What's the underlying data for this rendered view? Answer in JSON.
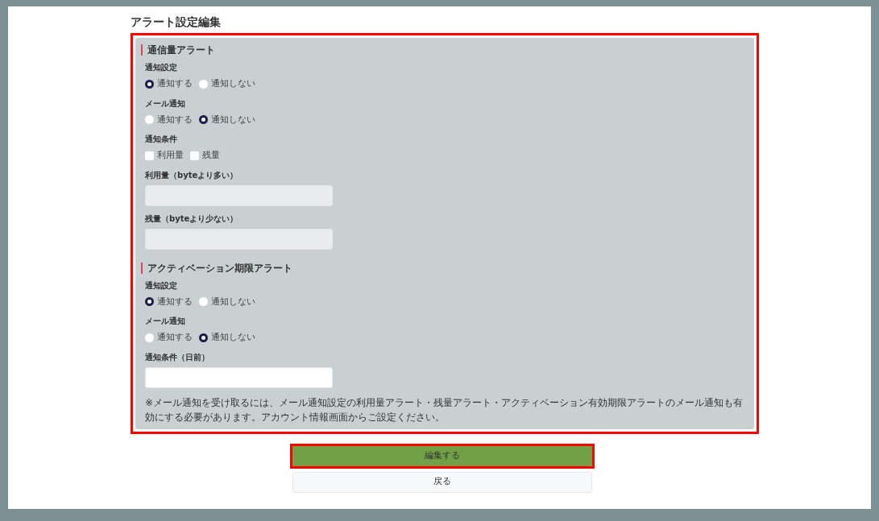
{
  "page_title": "アラート設定編集",
  "sections": [
    {
      "heading": "通信量アラート",
      "groups": [
        {
          "kind": "radio",
          "label": "通知設定",
          "options": [
            {
              "label": "通知する",
              "selected": true
            },
            {
              "label": "通知しない",
              "selected": false
            }
          ]
        },
        {
          "kind": "radio",
          "label": "メール通知",
          "options": [
            {
              "label": "通知する",
              "selected": false
            },
            {
              "label": "通知しない",
              "selected": true
            }
          ]
        },
        {
          "kind": "checkbox",
          "label": "通知条件",
          "options": [
            {
              "label": "利用量",
              "checked": false
            },
            {
              "label": "残量",
              "checked": false
            }
          ]
        },
        {
          "kind": "input",
          "label": "利用量（byteより多い）",
          "disabled": true
        },
        {
          "kind": "input",
          "label": "残量（byteより少ない）",
          "disabled": true
        }
      ]
    },
    {
      "heading": "アクティベーション期限アラート",
      "groups": [
        {
          "kind": "radio",
          "label": "通知設定",
          "options": [
            {
              "label": "通知する",
              "selected": true
            },
            {
              "label": "通知しない",
              "selected": false
            }
          ]
        },
        {
          "kind": "radio",
          "label": "メール通知",
          "options": [
            {
              "label": "通知する",
              "selected": false
            },
            {
              "label": "通知しない",
              "selected": true
            }
          ]
        },
        {
          "kind": "input",
          "label": "通知条件（日前）",
          "disabled": false
        }
      ]
    }
  ],
  "note": "※メール通知を受け取るには、メール通知設定の利用量アラート・残量アラート・アクティベーション有効期限アラートのメール通知も有効にする必要があります。アカウント情報画面からご設定ください。",
  "buttons": [
    {
      "kind": "primary",
      "label": "編集する"
    },
    {
      "kind": "secondary",
      "label": "戻る"
    }
  ]
}
